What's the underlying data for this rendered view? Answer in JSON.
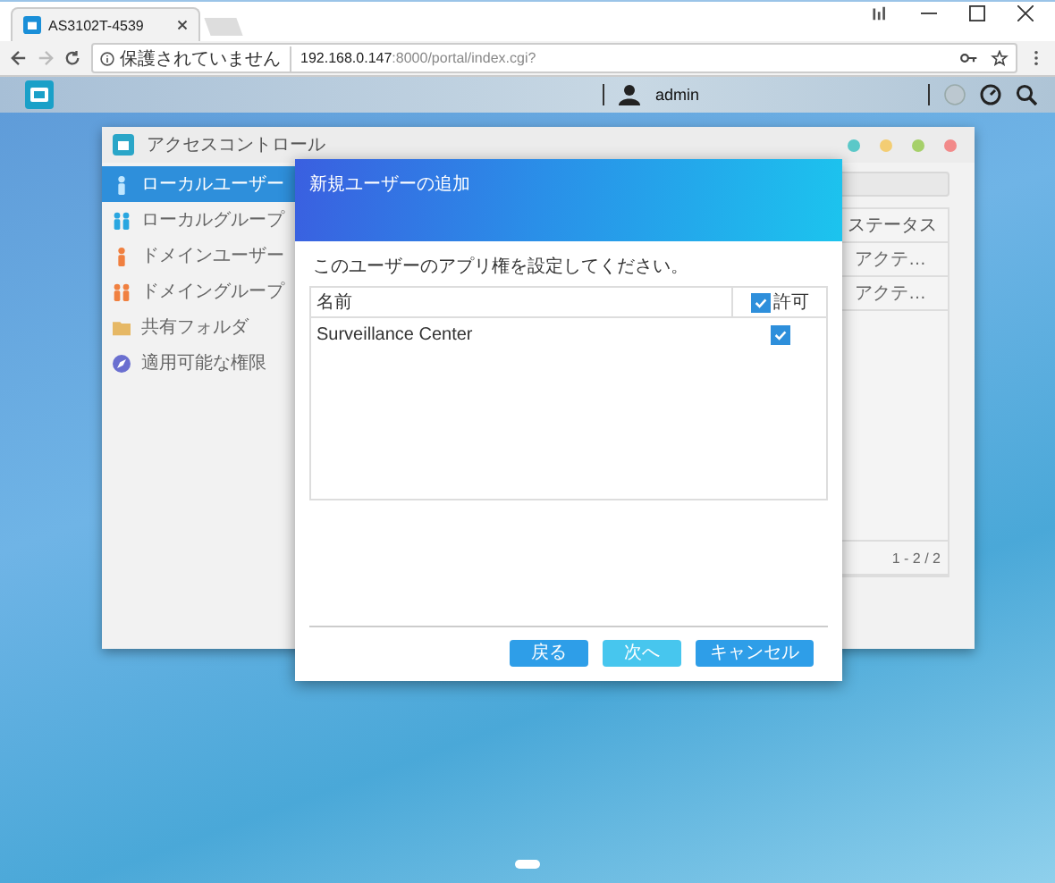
{
  "browser": {
    "tab_title": "AS3102T-4539",
    "security": "保護されていません",
    "url_host": "192.168.0.147",
    "url_path": ":8000/portal/index.cgi?"
  },
  "topbar": {
    "user": "admin"
  },
  "window": {
    "title": "アクセスコントロール",
    "controls": [
      {
        "color": "#5bc8c8"
      },
      {
        "color": "#f3cd73"
      },
      {
        "color": "#a6d06a"
      },
      {
        "color": "#f28a8a"
      }
    ],
    "sidebar": {
      "items": [
        {
          "label": "ローカルユーザー",
          "selected": true,
          "kind": "user"
        },
        {
          "label": "ローカルグループ",
          "selected": false,
          "kind": "group"
        },
        {
          "label": "ドメインユーザー",
          "selected": false,
          "kind": "domain-user"
        },
        {
          "label": "ドメイングループ",
          "selected": false,
          "kind": "domain-group"
        },
        {
          "label": "共有フォルダ",
          "selected": false,
          "kind": "folder"
        },
        {
          "label": "適用可能な権限",
          "selected": false,
          "kind": "permission"
        }
      ]
    },
    "table": {
      "column": "ステータス",
      "rows": [
        "アクテ…",
        "アクテ…"
      ],
      "pager": "1 - 2 / 2"
    }
  },
  "dialog": {
    "title": "新規ユーザーの追加",
    "instruction": "このユーザーのアプリ権を設定してください。",
    "columns": {
      "name": "名前",
      "allow": "許可",
      "allow_checked": true
    },
    "rows": [
      {
        "name": "Surveillance Center",
        "checked": true
      }
    ],
    "buttons": [
      {
        "label": "戻る",
        "hovered": false
      },
      {
        "label": "次へ",
        "hovered": true
      },
      {
        "label": "キャンセル",
        "hovered": false
      }
    ]
  }
}
